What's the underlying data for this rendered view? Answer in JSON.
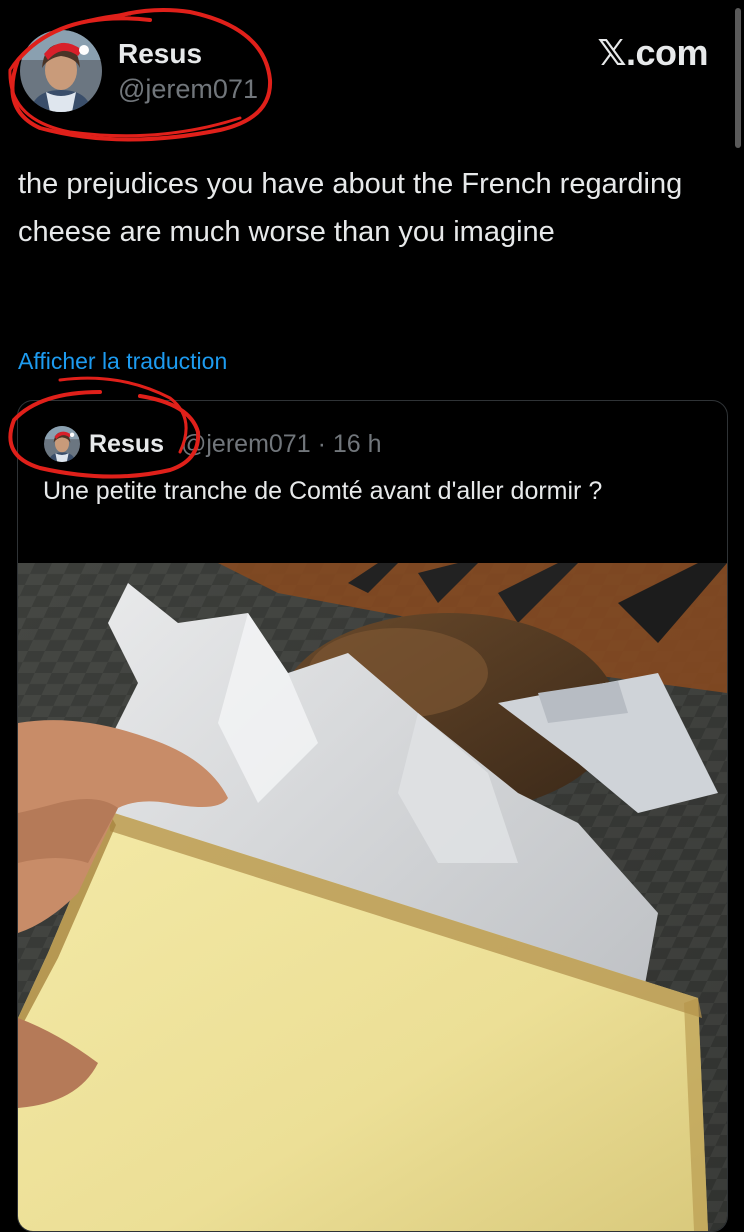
{
  "header": {
    "name": "Resus",
    "handle": "@jerem071",
    "brand": "𝕏.com"
  },
  "tweet": {
    "text": "the prejudices you have about the French regarding cheese are much worse than you imagine",
    "translate_link": "Afficher la traduction"
  },
  "quote": {
    "name": "Resus",
    "handle": "@jerem071",
    "separator": "·",
    "time": "16 h",
    "text": "Une petite tranche de Comté avant d'aller dormir ?"
  },
  "colors": {
    "background": "#000000",
    "text": "#e7e9ea",
    "muted": "#71767b",
    "link": "#1d9bf0",
    "annotation": "#e0201a"
  },
  "icons": {
    "brand": "x-logo",
    "avatar": "profile-photo"
  }
}
